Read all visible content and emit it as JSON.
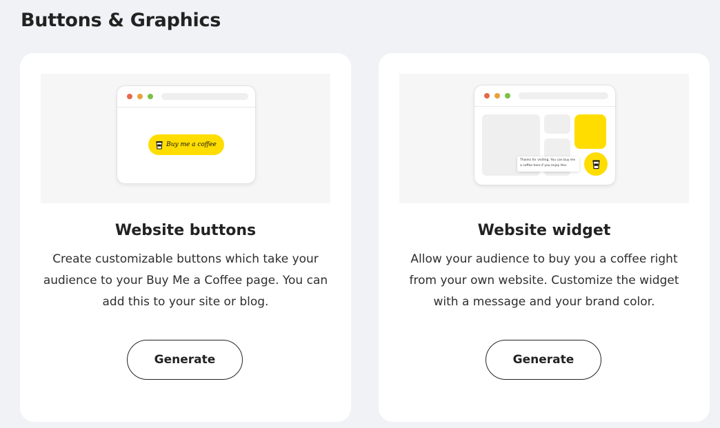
{
  "page": {
    "title": "Buttons & Graphics"
  },
  "cards": [
    {
      "title": "Website buttons",
      "description": "Create customizable buttons which take your audience to your Buy Me a Coffee page. You can add this to your site or blog.",
      "button_label": "Generate",
      "preview": {
        "button_text": "Buy me a coffee",
        "button_color": "#ffdd00"
      }
    },
    {
      "title": "Website widget",
      "description": "Allow your audience to buy you a coffee right from your own website. Customize the widget with a message and your brand color.",
      "button_label": "Generate",
      "preview": {
        "tooltip_text": "Thanks for visiting. You can buy me a coffee here if you enjoy this.",
        "accent_color": "#ffdd00"
      }
    }
  ],
  "icons": {
    "browser_dots": [
      "#e5694c",
      "#e8a23a",
      "#7cc146"
    ],
    "cup": "coffee-cup-icon"
  }
}
